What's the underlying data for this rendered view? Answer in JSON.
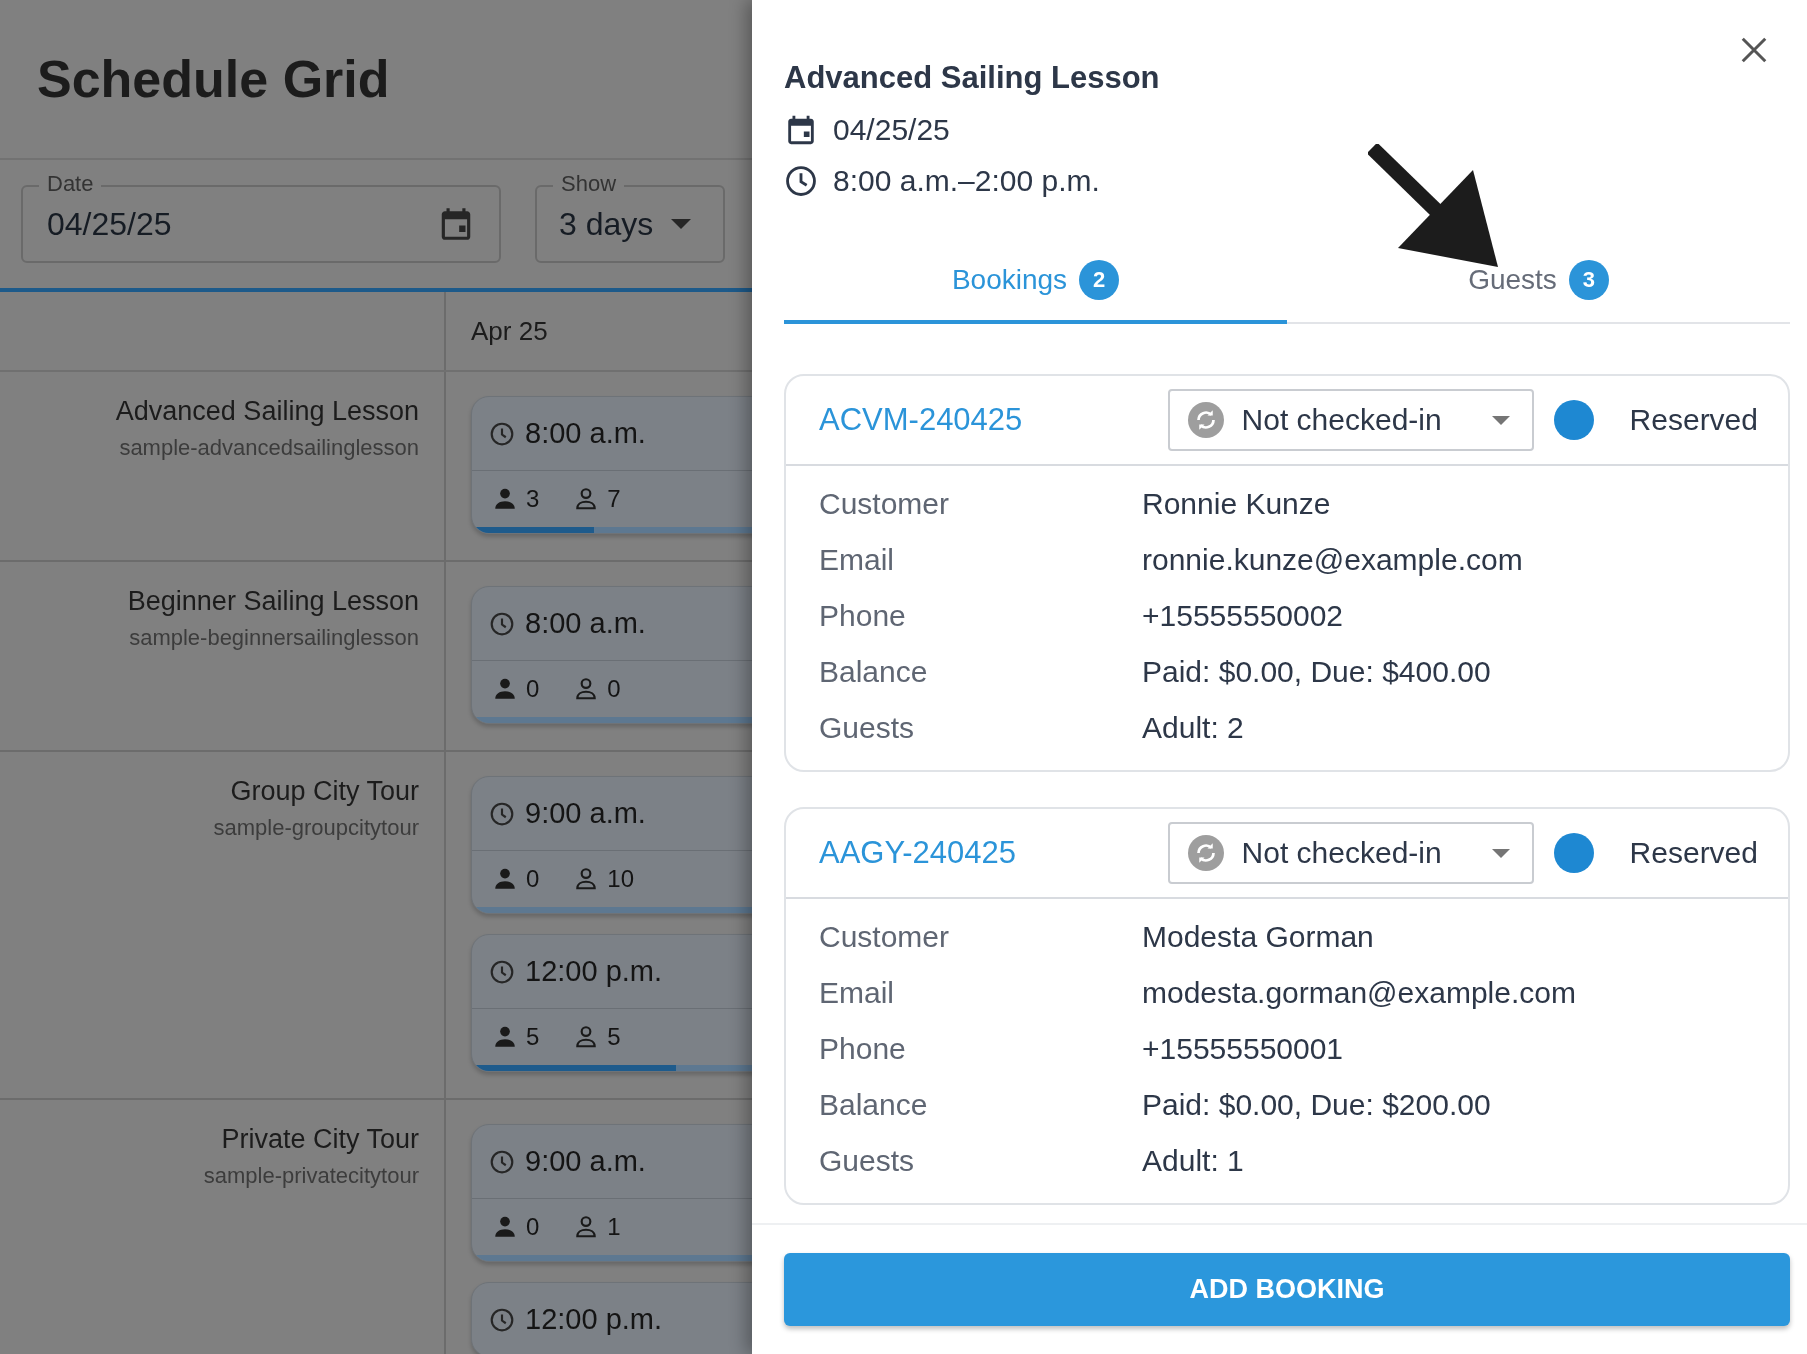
{
  "page": {
    "title": "Schedule Grid"
  },
  "filters": {
    "date": {
      "label": "Date",
      "value": "04/25/25"
    },
    "show": {
      "label": "Show",
      "value": "3 days"
    }
  },
  "grid": {
    "columns": [
      "Apr 25"
    ],
    "rows": [
      {
        "name": "Advanced Sailing Lesson",
        "code": "sample-advancedsailinglesson",
        "slots": [
          {
            "time": "8:00 a.m.",
            "booked": "3",
            "available": "7",
            "level": 0.3
          }
        ]
      },
      {
        "name": "Beginner Sailing Lesson",
        "code": "sample-beginnersailinglesson",
        "slots": [
          {
            "time": "8:00 a.m.",
            "booked": "0",
            "available": "0",
            "level": 0
          }
        ]
      },
      {
        "name": "Group City Tour",
        "code": "sample-groupcitytour",
        "slots": [
          {
            "time": "9:00 a.m.",
            "booked": "0",
            "available": "10",
            "level": 0
          },
          {
            "time": "12:00 p.m.",
            "booked": "5",
            "available": "5",
            "level": 0.5
          }
        ]
      },
      {
        "name": "Private City Tour",
        "code": "sample-privatecitytour",
        "slots": [
          {
            "time": "9:00 a.m.",
            "booked": "0",
            "available": "1",
            "level": 0
          },
          {
            "time": "12:00 p.m."
          }
        ]
      }
    ]
  },
  "drawer": {
    "title": "Advanced Sailing Lesson",
    "date": "04/25/25",
    "time": "8:00 a.m.–2:00 p.m.",
    "tabs": [
      {
        "label": "Bookings",
        "count": "2",
        "selected": true
      },
      {
        "label": "Guests",
        "count": "3",
        "selected": false
      }
    ],
    "bookings": [
      {
        "reference": "ACVM-240425",
        "check_in": "Not checked-in",
        "status": "Reserved",
        "color": "#1e88d2",
        "details": [
          {
            "label": "Customer",
            "value": "Ronnie Kunze"
          },
          {
            "label": "Email",
            "value": "ronnie.kunze@example.com"
          },
          {
            "label": "Phone",
            "value": "+15555550002"
          },
          {
            "label": "Balance",
            "value": "Paid: $0.00, Due: $400.00"
          },
          {
            "label": "Guests",
            "value": "Adult: 2"
          }
        ]
      },
      {
        "reference": "AAGY-240425",
        "check_in": "Not checked-in",
        "status": "Reserved",
        "color": "#1e88d2",
        "details": [
          {
            "label": "Customer",
            "value": "Modesta Gorman"
          },
          {
            "label": "Email",
            "value": "modesta.gorman@example.com"
          },
          {
            "label": "Phone",
            "value": "+15555550001"
          },
          {
            "label": "Balance",
            "value": "Paid: $0.00, Due: $200.00"
          },
          {
            "label": "Guests",
            "value": "Adult: 1"
          }
        ]
      }
    ],
    "action": "ADD BOOKING"
  }
}
